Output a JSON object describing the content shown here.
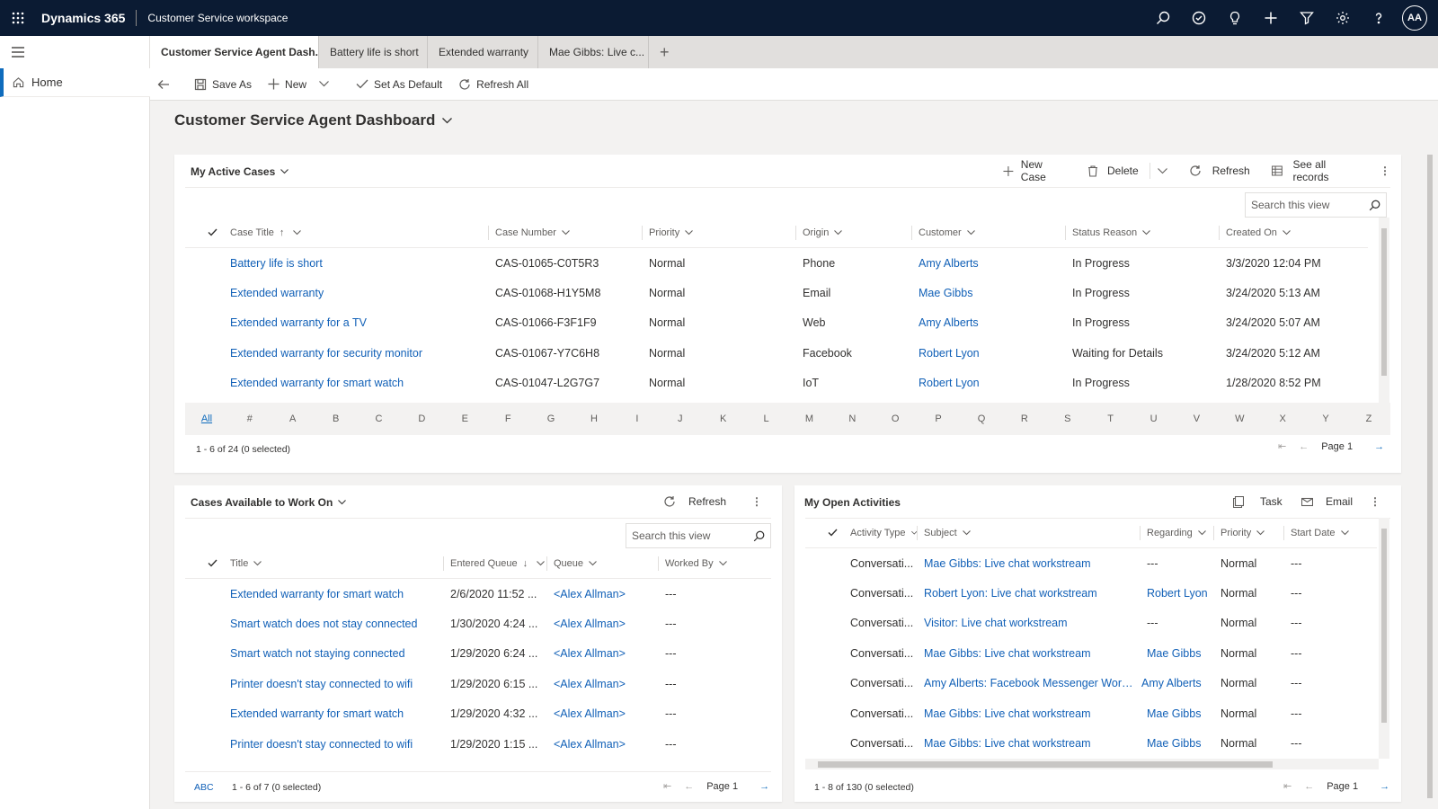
{
  "topbar": {
    "brand": "Dynamics 365",
    "app_name": "Customer Service workspace",
    "avatar_initials": "AA",
    "icons": [
      "waffle-icon",
      "search-icon",
      "task-icon",
      "lightbulb-icon",
      "plus-icon",
      "filter-icon",
      "gear-icon",
      "help-icon"
    ]
  },
  "leftnav": {
    "home_label": "Home"
  },
  "tabs": [
    {
      "label": "Customer Service Agent Dash..."
    },
    {
      "label": "Battery life is short"
    },
    {
      "label": "Extended warranty"
    },
    {
      "label": "Mae Gibbs: Live c..."
    }
  ],
  "tab_add": "+",
  "commands": {
    "save_as": "Save As",
    "new": "New",
    "set_default": "Set As Default",
    "refresh_all": "Refresh All"
  },
  "page_title": "Customer Service Agent Dashboard",
  "active_cases": {
    "title": "My Active Cases",
    "actions": {
      "new_case": "New Case",
      "delete": "Delete",
      "refresh": "Refresh",
      "see_all": "See all records"
    },
    "search_placeholder": "Search this view",
    "columns": [
      "Case Title",
      "Case Number",
      "Priority",
      "Origin",
      "Customer",
      "Status Reason",
      "Created On"
    ],
    "rows": [
      [
        "Battery life is short",
        "CAS-01065-C0T5R3",
        "Normal",
        "Phone",
        "Amy Alberts",
        "In Progress",
        "3/3/2020 12:04 PM"
      ],
      [
        "Extended warranty",
        "CAS-01068-H1Y5M8",
        "Normal",
        "Email",
        "Mae Gibbs",
        "In Progress",
        "3/24/2020 5:13 AM"
      ],
      [
        "Extended warranty for a TV",
        "CAS-01066-F3F1F9",
        "Normal",
        "Web",
        "Amy Alberts",
        "In Progress",
        "3/24/2020 5:07 AM"
      ],
      [
        "Extended warranty for security monitor",
        "CAS-01067-Y7C6H8",
        "Normal",
        "Facebook",
        "Robert Lyon",
        "Waiting for Details",
        "3/24/2020 5:12 AM"
      ],
      [
        "Extended warranty for smart watch",
        "CAS-01047-L2G7G7",
        "Normal",
        "IoT",
        "Robert Lyon",
        "In Progress",
        "1/28/2020 8:52 PM"
      ]
    ],
    "alphabet": [
      "All",
      "#",
      "A",
      "B",
      "C",
      "D",
      "E",
      "F",
      "G",
      "H",
      "I",
      "J",
      "K",
      "L",
      "M",
      "N",
      "O",
      "P",
      "Q",
      "R",
      "S",
      "T",
      "U",
      "V",
      "W",
      "X",
      "Y",
      "Z"
    ],
    "footer": "1 - 6 of 24 (0 selected)",
    "page": "Page 1"
  },
  "available_cases": {
    "title": "Cases Available to Work On",
    "refresh": "Refresh",
    "search_placeholder": "Search this view",
    "columns": [
      "Title",
      "Entered Queue",
      "Queue",
      "Worked By"
    ],
    "rows": [
      [
        "Extended warranty for smart watch",
        "2/6/2020 11:52 ...",
        "<Alex Allman>",
        "---"
      ],
      [
        "Smart watch does not stay connected",
        "1/30/2020 4:24 ...",
        "<Alex Allman>",
        "---"
      ],
      [
        "Smart watch not staying connected",
        "1/29/2020 6:24 ...",
        "<Alex Allman>",
        "---"
      ],
      [
        "Printer doesn't stay connected to wifi",
        "1/29/2020 6:15 ...",
        "<Alex Allman>",
        "---"
      ],
      [
        "Extended warranty for smart watch",
        "1/29/2020 4:32 ...",
        "<Alex Allman>",
        "---"
      ],
      [
        "Printer doesn't stay connected to wifi",
        "1/29/2020 1:15 ...",
        "<Alex Allman>",
        "---"
      ]
    ],
    "abc": "ABC",
    "footer": "1 - 6 of 7 (0 selected)",
    "page": "Page 1"
  },
  "open_activities": {
    "title": "My Open Activities",
    "actions": {
      "task": "Task",
      "email": "Email"
    },
    "columns": [
      "Activity Type",
      "Subject",
      "Regarding",
      "Priority",
      "Start Date"
    ],
    "rows": [
      [
        "Conversati...",
        "Mae Gibbs: Live chat workstream",
        "---",
        "Normal",
        "---"
      ],
      [
        "Conversati...",
        "Robert Lyon: Live chat workstream",
        "Robert Lyon",
        "Normal",
        "---"
      ],
      [
        "Conversati...",
        "Visitor: Live chat workstream",
        "---",
        "Normal",
        "---"
      ],
      [
        "Conversati...",
        "Mae Gibbs: Live chat workstream",
        "Mae Gibbs",
        "Normal",
        "---"
      ],
      [
        "Conversati...",
        "Amy Alberts: Facebook Messenger Workstream",
        "Amy Alberts",
        "Normal",
        "---"
      ],
      [
        "Conversati...",
        "Mae Gibbs: Live chat workstream",
        "Mae Gibbs",
        "Normal",
        "---"
      ],
      [
        "Conversati...",
        "Mae Gibbs: Live chat workstream",
        "Mae Gibbs",
        "Normal",
        "---"
      ]
    ],
    "footer": "1 - 8 of 130 (0 selected)",
    "page": "Page 1"
  },
  "colors": {
    "topbar": "#0b1b33",
    "link": "#1160b7",
    "accent": "#0f6cbd"
  }
}
